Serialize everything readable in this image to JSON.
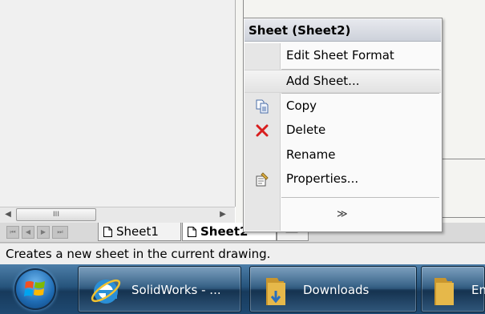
{
  "menu": {
    "title": "Sheet (Sheet2)",
    "items": [
      {
        "label": "Edit Sheet Format",
        "icon": "none"
      },
      {
        "label": "Add Sheet...",
        "icon": "none"
      },
      {
        "label": "Copy",
        "icon": "copy-icon"
      },
      {
        "label": "Delete",
        "icon": "delete-x-icon"
      },
      {
        "label": "Rename",
        "icon": "none"
      },
      {
        "label": "Properties...",
        "icon": "properties-icon"
      }
    ],
    "expand_glyph": "≫"
  },
  "scrollbar": {
    "left_glyph": "◀",
    "thumb_grip": "III",
    "right_glyph": "▶"
  },
  "sheet_tabs": {
    "nav_glyphs": [
      "⏮",
      "◀",
      "▶",
      "⏭"
    ],
    "tabs": [
      {
        "label": "Sheet1",
        "active": false
      },
      {
        "label": "Sheet2",
        "active": true
      }
    ]
  },
  "status": {
    "message": "Creates a new sheet in the current drawing."
  },
  "taskbar": {
    "buttons": [
      {
        "label": "SolidWorks - ...",
        "icon": "internet-explorer-icon"
      },
      {
        "label": "Downloads",
        "icon": "folder-icon"
      },
      {
        "label": "En",
        "icon": "folder-icon"
      }
    ]
  },
  "colors": {
    "delete_red": "#d81e1e",
    "folder_yellow": "#e6b84a",
    "ie_blue": "#2b8fd6"
  }
}
